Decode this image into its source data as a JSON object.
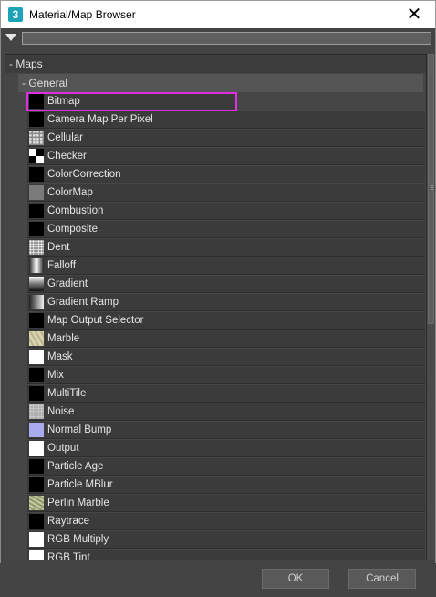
{
  "window": {
    "title": "Material/Map Browser",
    "app_icon": "3",
    "close_glyph": "✕"
  },
  "search": {
    "value": "",
    "placeholder": ""
  },
  "tree": {
    "maps_label": "- Maps",
    "general_label": "- General",
    "items": [
      {
        "label": "Bitmap",
        "swatch": "black",
        "selected": true
      },
      {
        "label": "Camera Map Per Pixel",
        "swatch": "black"
      },
      {
        "label": "Cellular",
        "swatch": "cellular"
      },
      {
        "label": "Checker",
        "swatch": "checker"
      },
      {
        "label": "ColorCorrection",
        "swatch": "black"
      },
      {
        "label": "ColorMap",
        "swatch": "gray"
      },
      {
        "label": "Combustion",
        "swatch": "black"
      },
      {
        "label": "Composite",
        "swatch": "black"
      },
      {
        "label": "Dent",
        "swatch": "dent"
      },
      {
        "label": "Falloff",
        "swatch": "falloff"
      },
      {
        "label": "Gradient",
        "swatch": "gradient"
      },
      {
        "label": "Gradient Ramp",
        "swatch": "gradient-ramp"
      },
      {
        "label": "Map Output Selector",
        "swatch": "black"
      },
      {
        "label": "Marble",
        "swatch": "marble"
      },
      {
        "label": "Mask",
        "swatch": "white"
      },
      {
        "label": "Mix",
        "swatch": "black"
      },
      {
        "label": "MultiTile",
        "swatch": "black"
      },
      {
        "label": "Noise",
        "swatch": "noise"
      },
      {
        "label": "Normal Bump",
        "swatch": "lavender"
      },
      {
        "label": "Output",
        "swatch": "white"
      },
      {
        "label": "Particle Age",
        "swatch": "black"
      },
      {
        "label": "Particle MBlur",
        "swatch": "black"
      },
      {
        "label": "Perlin Marble",
        "swatch": "perlin"
      },
      {
        "label": "Raytrace",
        "swatch": "black"
      },
      {
        "label": "RGB Multiply",
        "swatch": "white"
      },
      {
        "label": "RGB Tint",
        "swatch": "white"
      }
    ]
  },
  "footer": {
    "ok_label": "OK",
    "cancel_label": "Cancel"
  },
  "colors": {
    "selection": "#e02fe0",
    "background": "#444444",
    "normal_bump": "#aaaaee"
  }
}
